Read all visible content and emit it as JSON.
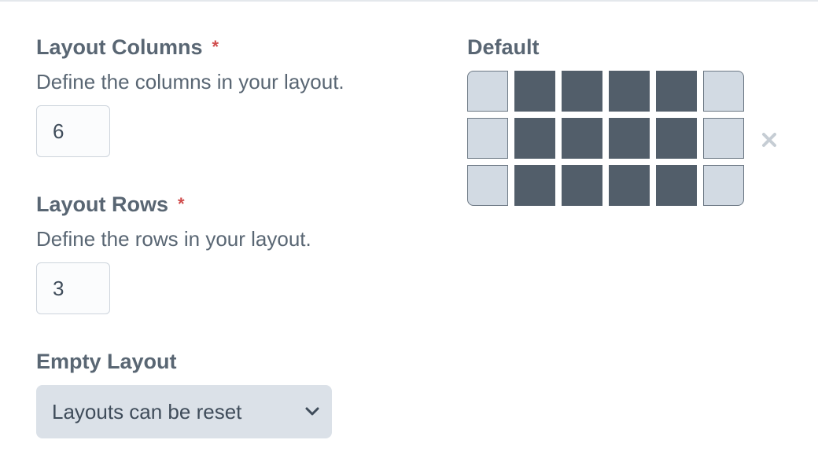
{
  "fields": {
    "columns": {
      "label": "Layout Columns",
      "required_marker": "*",
      "help": "Define the columns in your layout.",
      "value": "6"
    },
    "rows": {
      "label": "Layout Rows",
      "required_marker": "*",
      "help": "Define the rows in your layout.",
      "value": "3"
    },
    "empty_layout": {
      "label": "Empty Layout",
      "selected": "Layouts can be reset"
    }
  },
  "preview": {
    "title": "Default",
    "grid": {
      "columns": 6,
      "rows": 3,
      "cells": [
        [
          "empty",
          "filled",
          "filled",
          "filled",
          "filled",
          "empty"
        ],
        [
          "empty",
          "filled",
          "filled",
          "filled",
          "filled",
          "empty"
        ],
        [
          "empty",
          "filled",
          "filled",
          "filled",
          "filled",
          "empty"
        ]
      ]
    },
    "clear_icon": "close-icon"
  },
  "colors": {
    "text": "#596673",
    "required": "#d04c4c",
    "filled_cell": "#525e6a",
    "empty_cell": "#d2dae3",
    "select_bg": "#dbe1e8"
  }
}
